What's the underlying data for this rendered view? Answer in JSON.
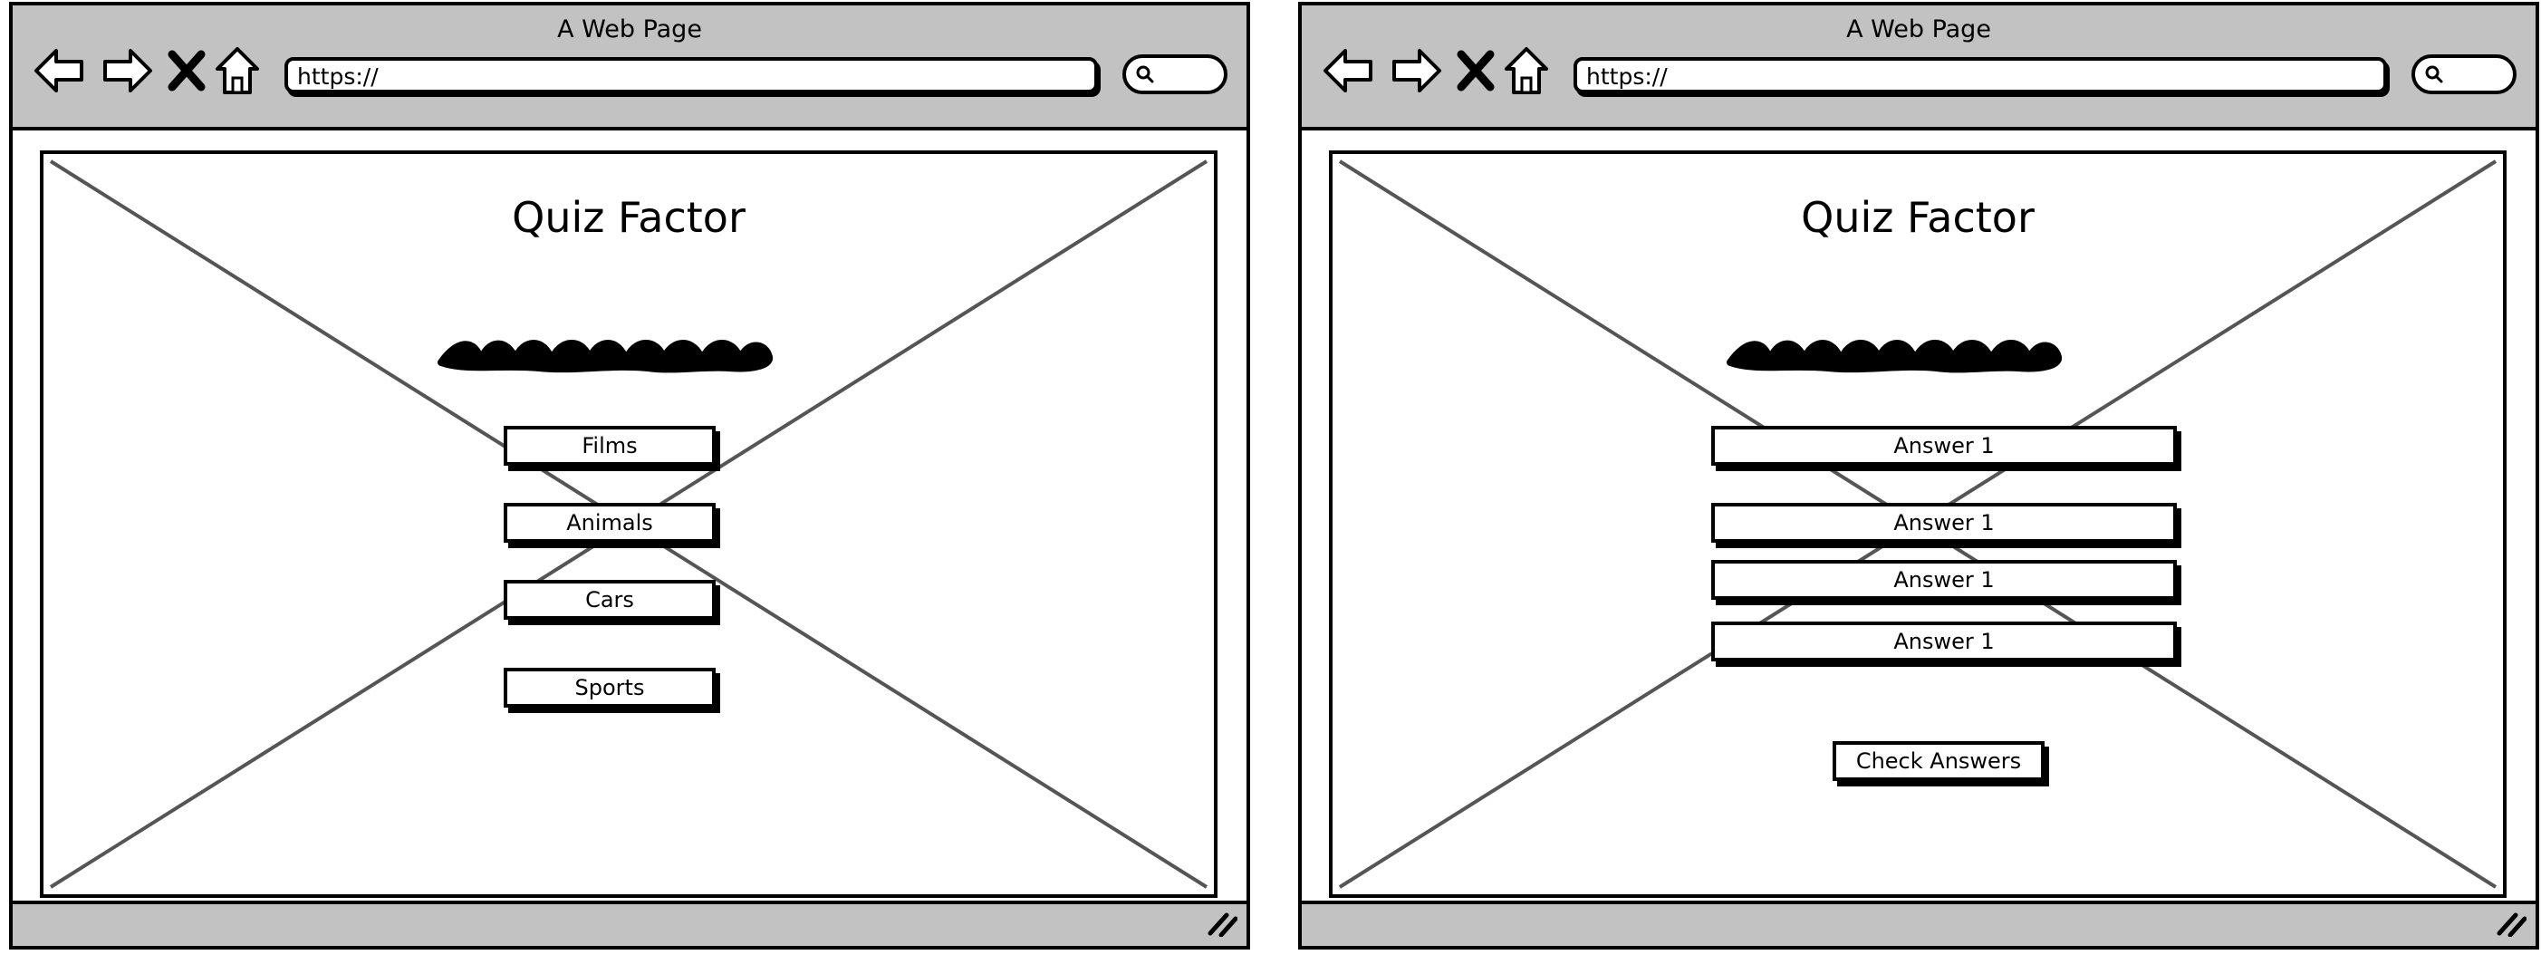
{
  "windows": [
    {
      "title": "A Web Page",
      "address": "https://",
      "page_title": "Quiz Factor",
      "buttons": [
        "Films",
        "Animals",
        "Cars",
        "Sports"
      ]
    },
    {
      "title": "A Web Page",
      "address": "https://",
      "page_title": "Quiz Factor",
      "answers": [
        "Answer 1",
        "Answer 1",
        "Answer 1",
        "Answer 1"
      ],
      "check_label": "Check Answers"
    }
  ],
  "icons": {
    "back": "arrow-left-icon",
    "forward": "arrow-right-icon",
    "stop": "close-icon",
    "home": "home-icon",
    "search": "search-icon",
    "resize": "resize-grip-icon"
  },
  "colors": {
    "chrome": "#c2c2c2",
    "ink": "#000000",
    "placeholder_line": "#555555"
  }
}
